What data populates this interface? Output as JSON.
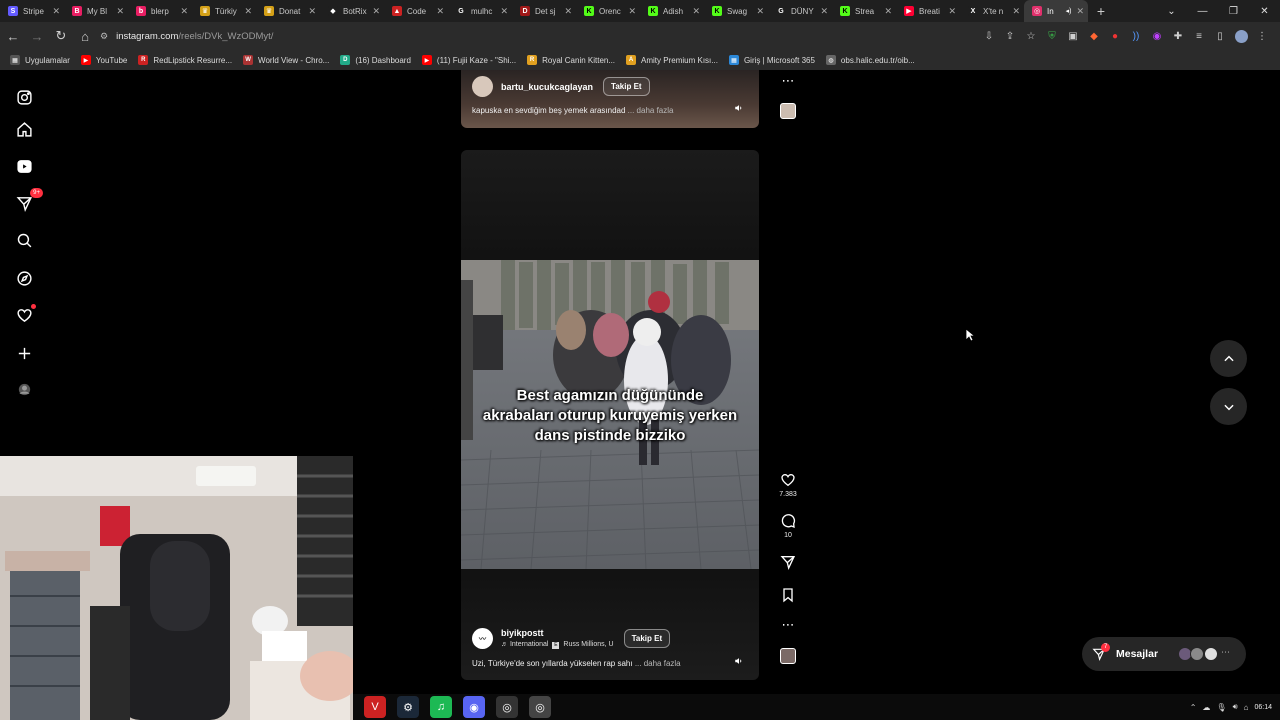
{
  "browser": {
    "tabs": [
      {
        "label": "Stripe",
        "icon": "stripe-icon",
        "color": "#635bff",
        "glyph": "S"
      },
      {
        "label": "My Bl",
        "icon": "blog-icon",
        "color": "#e91e63",
        "glyph": "B"
      },
      {
        "label": "blerp",
        "icon": "blerp-icon",
        "color": "#e91e63",
        "glyph": "b"
      },
      {
        "label": "Türkiy",
        "icon": "crown-icon",
        "color": "#d4a017",
        "glyph": "♛"
      },
      {
        "label": "Donat",
        "icon": "crown-icon",
        "color": "#d4a017",
        "glyph": "♛"
      },
      {
        "label": "BotRix",
        "icon": "botrix-icon",
        "color": "#ffffff",
        "glyph": "◆"
      },
      {
        "label": "Code",
        "icon": "code-icon",
        "color": "#cc2222",
        "glyph": "▲"
      },
      {
        "label": "mulhc",
        "icon": "google-icon",
        "color": "#ffffff",
        "glyph": "G"
      },
      {
        "label": "Det sj",
        "icon": "det-icon",
        "color": "#a01818",
        "glyph": "D"
      },
      {
        "label": "Orenc",
        "icon": "kick-icon",
        "color": "#53fc18",
        "glyph": "K"
      },
      {
        "label": "Adish",
        "icon": "kick-icon",
        "color": "#53fc18",
        "glyph": "K"
      },
      {
        "label": "Swag",
        "icon": "kick-icon",
        "color": "#53fc18",
        "glyph": "K"
      },
      {
        "label": "DÜNY",
        "icon": "google-icon",
        "color": "#ffffff",
        "glyph": "G"
      },
      {
        "label": "Strea",
        "icon": "kick-icon",
        "color": "#53fc18",
        "glyph": "K"
      },
      {
        "label": "Breati",
        "icon": "youtube-icon",
        "color": "#ff0033",
        "glyph": "▶"
      },
      {
        "label": "X'te n",
        "icon": "x-icon",
        "color": "#ffffff",
        "glyph": "X"
      },
      {
        "label": "In",
        "icon": "instagram-icon",
        "color": "#e1306c",
        "glyph": "◎",
        "active": true
      }
    ],
    "url_domain": "instagram.com",
    "url_path": "/reels/DVk_WzODMyt/",
    "bookmarks": [
      {
        "label": "Uygulamalar",
        "icon": "apps-grid-icon",
        "color": "#555555",
        "glyph": "▦"
      },
      {
        "label": "YouTube",
        "icon": "youtube-icon",
        "color": "#ff0000",
        "glyph": "▶"
      },
      {
        "label": "RedLipstick Resurre...",
        "icon": "redlipstick-icon",
        "color": "#cc2222",
        "glyph": "R"
      },
      {
        "label": "World View - Chro...",
        "icon": "worldview-icon",
        "color": "#aa3333",
        "glyph": "W"
      },
      {
        "label": "(16) Dashboard",
        "icon": "dashboard-icon",
        "color": "#22aa88",
        "glyph": "D"
      },
      {
        "label": "(11) Fujii Kaze - \"Shi...",
        "icon": "youtube-icon",
        "color": "#ff0000",
        "glyph": "▶"
      },
      {
        "label": "Royal Canin Kitten...",
        "icon": "royalcanin-icon",
        "color": "#e0a020",
        "glyph": "R"
      },
      {
        "label": "Amity Premium Kısı...",
        "icon": "amity-icon",
        "color": "#e0a020",
        "glyph": "A"
      },
      {
        "label": "Giriş | Microsoft 365",
        "icon": "microsoft-icon",
        "color": "#2b88d8",
        "glyph": "▦"
      },
      {
        "label": "obs.halic.edu.tr/oib...",
        "icon": "globe-icon",
        "color": "#666666",
        "glyph": "◍"
      }
    ]
  },
  "reel_top": {
    "username": "bartu_kucukcaglayan",
    "follow_label": "Takip Et",
    "caption": "kapuska en sevdiğim beş yemek arasındad",
    "more_label": "... daha fazla"
  },
  "reel_main": {
    "overlay_text": "Best agamızın düğününde akrabaları oturup kuruyemiş yerken dans pistinde bizziko",
    "username": "biyikpostt",
    "follow_label": "Takip Et",
    "audio": "International",
    "audio_artist": "Russ Millions, U",
    "caption": "Uzi, Türkiye'de son yıllarda yükselen rap sahı",
    "more_label": "... daha fazla",
    "likes": "7.383",
    "comments": "10"
  },
  "sidenav": {
    "notifications_badge": "9+"
  },
  "messages": {
    "label": "Mesajlar",
    "badge": "7"
  },
  "taskbar": {
    "apps": [
      {
        "icon": "voicemeeter-icon",
        "color": "#cc2222",
        "glyph": "V"
      },
      {
        "icon": "steam-icon",
        "color": "#1b2838",
        "glyph": "⚙"
      },
      {
        "icon": "spotify-icon",
        "color": "#1db954",
        "glyph": "♫"
      },
      {
        "icon": "discord-icon",
        "color": "#5865f2",
        "glyph": "◉"
      },
      {
        "icon": "obs-icon",
        "color": "#333333",
        "glyph": "◎"
      },
      {
        "icon": "chrome-icon",
        "color": "#444444",
        "glyph": "◎"
      }
    ],
    "time": "06:14"
  },
  "colors": {
    "accent_red": "#ff3040",
    "kick_green": "#53fc18",
    "page_bg": "#000000"
  }
}
